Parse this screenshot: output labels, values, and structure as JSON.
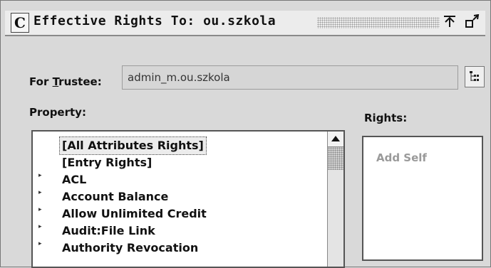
{
  "window": {
    "title": "Effective Rights To: ou.szkola"
  },
  "trustee": {
    "label_prefix": "For ",
    "label_accel": "T",
    "label_rest": "rustee:",
    "value": "admin_m.ou.szkola"
  },
  "property": {
    "heading": "Property:",
    "items": [
      {
        "label": "[All Attributes Rights]",
        "expandable": false,
        "selected": true
      },
      {
        "label": "[Entry Rights]",
        "expandable": false,
        "selected": false
      },
      {
        "label": "ACL",
        "expandable": true,
        "selected": false
      },
      {
        "label": "Account Balance",
        "expandable": true,
        "selected": false
      },
      {
        "label": "Allow Unlimited Credit",
        "expandable": true,
        "selected": false
      },
      {
        "label": "Audit:File Link",
        "expandable": true,
        "selected": false
      },
      {
        "label": "Authority Revocation",
        "expandable": true,
        "selected": false
      }
    ]
  },
  "rights": {
    "heading": "Rights:",
    "items": [
      "Add Self"
    ]
  },
  "icons": {
    "title": "window-menu-icon",
    "minimize": "minimize-arrow-icon",
    "restore": "restore-icon",
    "browse": "browse-tree-icon",
    "scroll_up": "scroll-up-arrow-icon",
    "expander": "expand-triangle-icon"
  }
}
